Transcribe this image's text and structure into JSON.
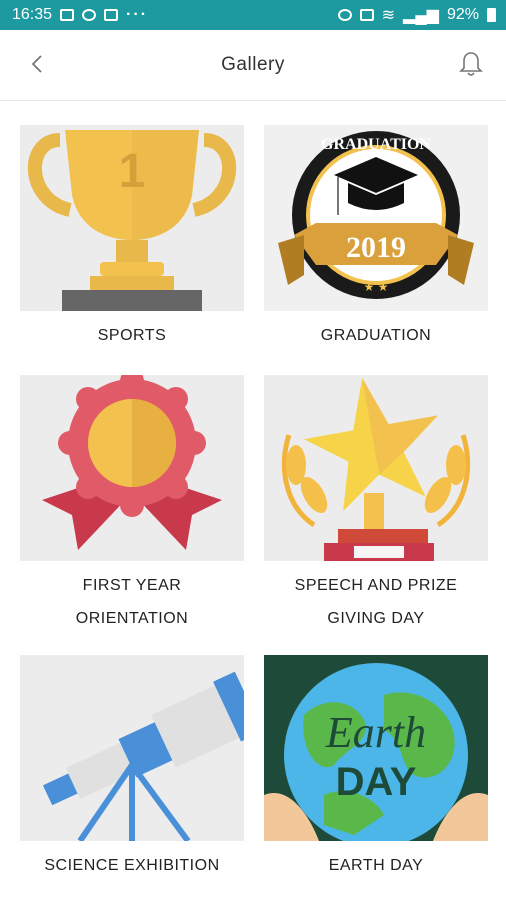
{
  "status": {
    "time": "16:35",
    "battery": "92%"
  },
  "header": {
    "title": "Gallery"
  },
  "gallery": [
    {
      "label_lines": [
        "SPORTS"
      ]
    },
    {
      "label_lines": [
        "GRADUATION"
      ],
      "badge_top": "GRADUATION",
      "badge_year": "2019"
    },
    {
      "label_lines": [
        "FIRST YEAR",
        "ORIENTATION"
      ]
    },
    {
      "label_lines": [
        "SPEECH AND PRIZE",
        "GIVING DAY"
      ]
    },
    {
      "label_lines": [
        "SCIENCE EXHIBITION"
      ]
    },
    {
      "label_lines": [
        "EARTH DAY"
      ],
      "art_line1": "Earth",
      "art_line2": "DAY"
    }
  ],
  "colors": {
    "statusbar": "#1d9aa0",
    "gold": "#f2c14e",
    "ribbon": "#d04a58",
    "telescope": "#4a90d9"
  }
}
